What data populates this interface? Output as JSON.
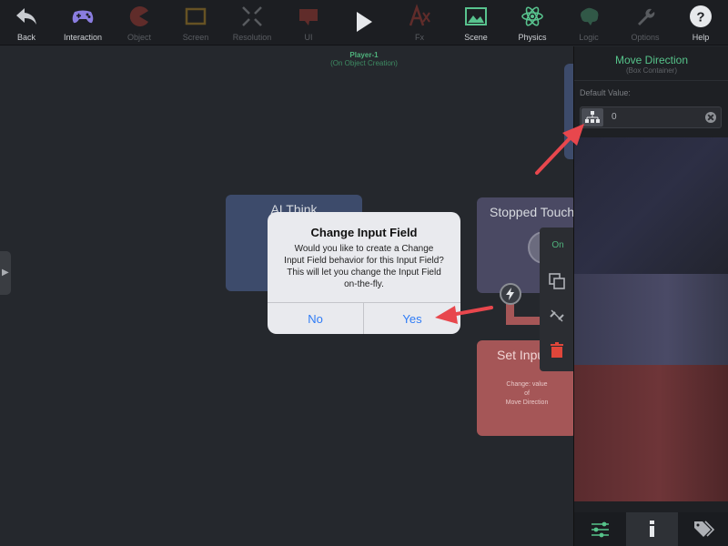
{
  "toolbar": {
    "items": [
      {
        "label": "Back",
        "icon": "back-arrow-icon"
      },
      {
        "label": "Interaction",
        "icon": "gamepad-icon"
      },
      {
        "label": "Object",
        "icon": "pacman-icon"
      },
      {
        "label": "Screen",
        "icon": "screen-frame-icon"
      },
      {
        "label": "Resolution",
        "icon": "expand-arrows-icon"
      },
      {
        "label": "UI",
        "icon": "chat-bubble-icon"
      },
      {
        "label": "",
        "icon": "play-icon"
      },
      {
        "label": "Fx",
        "icon": "text-effect-icon"
      },
      {
        "label": "Scene",
        "icon": "image-icon"
      },
      {
        "label": "Physics",
        "icon": "atom-icon"
      },
      {
        "label": "Logic",
        "icon": "brain-icon"
      },
      {
        "label": "Options",
        "icon": "wrench-icon"
      },
      {
        "label": "Help",
        "icon": "help-icon"
      }
    ]
  },
  "canvas": {
    "player_title": "Player-1",
    "player_subtitle": "(On Object Creation)",
    "nodes": {
      "ai_think": "AI Think",
      "stopped_touch": "Stopped Touch",
      "set_input": "Set Input",
      "set_input_desc": [
        "Change: value",
        "of",
        "Move Direction"
      ]
    },
    "mini_menu": {
      "on_label": "On"
    }
  },
  "panel": {
    "title": "Move Direction",
    "subtitle": "(Box Container)",
    "default_label": "Default Value:",
    "value": "0"
  },
  "dialog": {
    "title": "Change Input Field",
    "message": "Would you like to create a Change Input Field behavior for this Input Field? This will let you change the Input Field on-the-fly.",
    "no_label": "No",
    "yes_label": "Yes"
  },
  "colors": {
    "accent_green": "#56c38a",
    "ios_blue": "#2f7cf6",
    "annotation_red": "#e8474d"
  }
}
